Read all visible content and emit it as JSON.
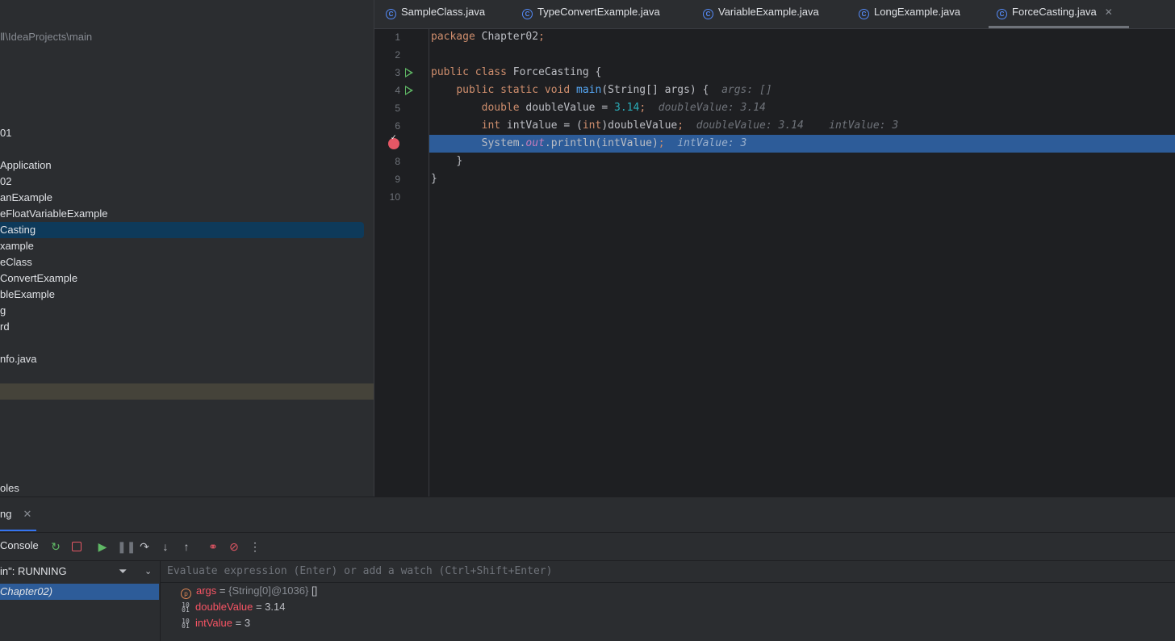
{
  "project": {
    "path": "Ⅱ\\IdeaProjects\\main",
    "items": [
      {
        "label": "01"
      },
      {
        "label": "Application"
      },
      {
        "label": "02"
      },
      {
        "label": "anExample"
      },
      {
        "label": "eFloatVariableExample"
      },
      {
        "label": "Casting"
      },
      {
        "label": "xample"
      },
      {
        "label": "eClass"
      },
      {
        "label": "ConvertExample"
      },
      {
        "label": "bleExample"
      },
      {
        "label": "g"
      },
      {
        "label": "rd"
      },
      {
        "label": "nfo.java"
      },
      {
        "label": ""
      },
      {
        "label": "oles"
      }
    ]
  },
  "editor": {
    "tabs": [
      {
        "label": "SampleClass.java",
        "icon": "class-icon"
      },
      {
        "label": "TypeConvertExample.java",
        "icon": "class-icon"
      },
      {
        "label": "VariableExample.java",
        "icon": "class-icon"
      },
      {
        "label": "LongExample.java",
        "icon": "class-icon"
      },
      {
        "label": "ForceCasting.java",
        "icon": "class-icon",
        "active": true
      }
    ],
    "line_numbers": [
      "1",
      "2",
      "3",
      "4",
      "5",
      "6",
      "7",
      "8",
      "9",
      "10"
    ],
    "code": {
      "l1_kw": "package",
      "l1_rest": " Chapter02",
      "l1_semi": ";",
      "l3_kw": "public class",
      "l3_rest": " ForceCasting {",
      "l4_kw": "public static void",
      "l4_fn": "main",
      "l4_rest": "(String[] args) {",
      "l4_hint": "args: []",
      "l5_kw": "double",
      "l5_rest": " doubleValue = ",
      "l5_num": "3.14",
      "l5_semi": ";",
      "l5_hint": "doubleValue: 3.14",
      "l6_kw": "int",
      "l6_rest1": " intValue = (",
      "l6_kw2": "int",
      "l6_rest2": ")doubleValue",
      "l6_semi": ";",
      "l6_hint1": "doubleValue: 3.14",
      "l6_hint2": "intValue: 3",
      "l7_pre": "System.",
      "l7_fld": "out",
      "l7_rest": ".println(intValue)",
      "l7_semi": ";",
      "l7_hint": "intValue: 3",
      "l8": "}",
      "l9": "}"
    }
  },
  "debug": {
    "tab_label": "ng",
    "console_label": "Console",
    "thread_label": "in\": RUNNING",
    "frame_label": "Chapter02)",
    "eval_placeholder": "Evaluate expression (Enter) or add a watch (Ctrl+Shift+Enter)",
    "variables": [
      {
        "name": "args",
        "type": "{String[0]@1036}",
        "value": "[]",
        "icon": "param-icon"
      },
      {
        "name": "doubleValue",
        "value": "3.14",
        "icon": "primitive-icon"
      },
      {
        "name": "intValue",
        "value": "3",
        "icon": "primitive-icon"
      }
    ]
  },
  "colors": {
    "accent": "#3574f0",
    "exec_line": "#2d5c99",
    "breakpoint": "#e55765",
    "run": "#5fb865"
  }
}
